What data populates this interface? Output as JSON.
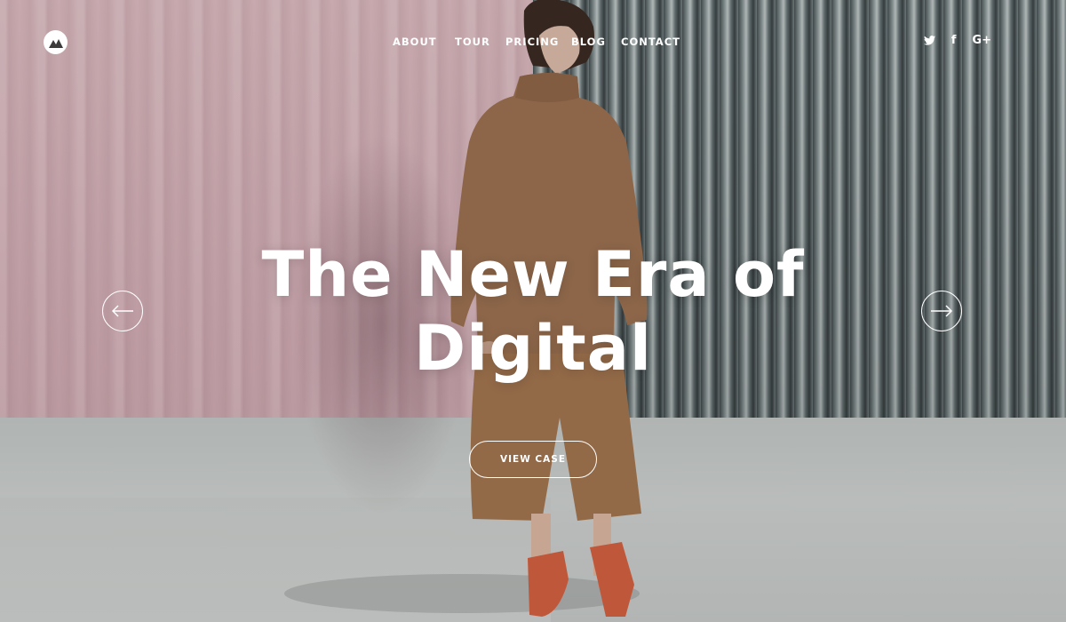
{
  "nav": {
    "items": [
      "ABOUT",
      "TOUR",
      "PRICING",
      "BLOG",
      "CONTACT"
    ]
  },
  "social": {
    "twitter": "twitter-icon",
    "facebook": "f",
    "google": "G+"
  },
  "hero": {
    "headline_line1": "The New Era of",
    "headline_line2": "Digital",
    "cta_label": "VIEW CASE"
  },
  "colors": {
    "text": "#ffffff",
    "pink_wall": "#d3b2b8",
    "steel_wall": "#6d7778",
    "floor": "#c6c9c7",
    "garment": "#9a6f50",
    "sandals": "#d0603f"
  }
}
